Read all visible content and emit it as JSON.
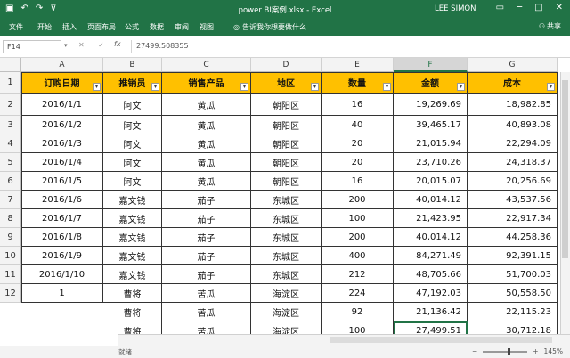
{
  "titlebar": {
    "title": "power BI案例.xlsx - Excel",
    "user": "LEE SIMON"
  },
  "tabs": [
    "文件",
    "开始",
    "插入",
    "页面布局",
    "公式",
    "数据",
    "审阅",
    "视图"
  ],
  "tellme": "告诉我你想要做什么",
  "share": "共享",
  "formula": {
    "namebox": "F14",
    "value": "27499.508355"
  },
  "columns": [
    "A",
    "B",
    "C",
    "D",
    "E",
    "F",
    "G"
  ],
  "rows": [
    "1",
    "2",
    "3",
    "4",
    "5",
    "6",
    "7",
    "8",
    "9",
    "10",
    "11",
    "12",
    "13",
    "14"
  ],
  "headers": [
    "订购日期",
    "推销员",
    "销售产品",
    "地区",
    "数量",
    "金额",
    "成本"
  ],
  "data": [
    [
      "2016/1/1",
      "阿文",
      "黄瓜",
      "朝阳区",
      "16",
      "19,269.69",
      "18,982.85"
    ],
    [
      "2016/1/2",
      "阿文",
      "黄瓜",
      "朝阳区",
      "40",
      "39,465.17",
      "40,893.08"
    ],
    [
      "2016/1/3",
      "阿文",
      "黄瓜",
      "朝阳区",
      "20",
      "21,015.94",
      "22,294.09"
    ],
    [
      "2016/1/4",
      "阿文",
      "黄瓜",
      "朝阳区",
      "20",
      "23,710.26",
      "24,318.37"
    ],
    [
      "2016/1/5",
      "阿文",
      "黄瓜",
      "朝阳区",
      "16",
      "20,015.07",
      "20,256.69"
    ],
    [
      "2016/1/6",
      "嘉文钱",
      "茄子",
      "东城区",
      "200",
      "40,014.12",
      "43,537.56"
    ],
    [
      "2016/1/7",
      "嘉文钱",
      "茄子",
      "东城区",
      "100",
      "21,423.95",
      "22,917.34"
    ],
    [
      "2016/1/8",
      "嘉文钱",
      "茄子",
      "东城区",
      "200",
      "40,014.12",
      "44,258.36"
    ],
    [
      "2016/1/9",
      "嘉文钱",
      "茄子",
      "东城区",
      "400",
      "84,271.49",
      "92,391.15"
    ],
    [
      "2016/1/10",
      "嘉文钱",
      "茄子",
      "东城区",
      "212",
      "48,705.66",
      "51,700.03"
    ],
    [
      "1",
      "曹将",
      "苦瓜",
      "海淀区",
      "224",
      "47,192.03",
      "50,558.50"
    ],
    [
      "2",
      "曹将",
      "苦瓜",
      "海淀区",
      "92",
      "21,136.42",
      "22,115.23"
    ],
    [
      "3",
      "曹将",
      "苦瓜",
      "海淀区",
      "100",
      "27,499.51",
      "30,712.18"
    ]
  ],
  "status": {
    "ready": "就绪",
    "zoom": "145%"
  }
}
